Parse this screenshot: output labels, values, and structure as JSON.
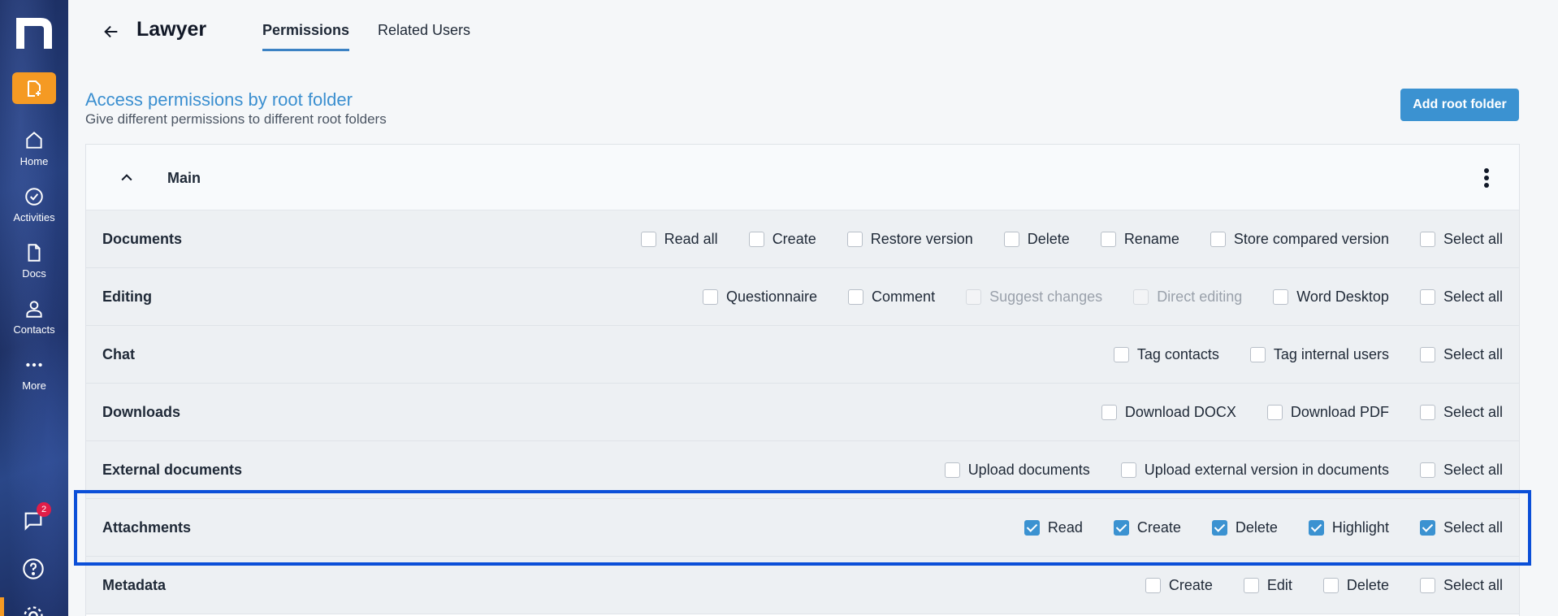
{
  "sidebar": {
    "items": [
      {
        "label": "Home",
        "icon": "home-icon"
      },
      {
        "label": "Activities",
        "icon": "check-circle-icon"
      },
      {
        "label": "Docs",
        "icon": "document-icon"
      },
      {
        "label": "Contacts",
        "icon": "person-icon"
      },
      {
        "label": "More",
        "icon": "more-dots-icon"
      }
    ],
    "chat_badge": "2",
    "colors": {
      "accent": "#f59a23",
      "badge": "#e11d48"
    }
  },
  "header": {
    "title": "Lawyer",
    "tabs": [
      {
        "label": "Permissions",
        "active": true
      },
      {
        "label": "Related Users",
        "active": false
      }
    ]
  },
  "section": {
    "title": "Access permissions by root folder",
    "subtitle": "Give different permissions to different root folders",
    "add_button": "Add root folder"
  },
  "folder": {
    "name": "Main",
    "rows": [
      {
        "label": "Documents",
        "options": [
          {
            "label": "Read all",
            "checked": false,
            "disabled": false
          },
          {
            "label": "Create",
            "checked": false,
            "disabled": false
          },
          {
            "label": "Restore version",
            "checked": false,
            "disabled": false
          },
          {
            "label": "Delete",
            "checked": false,
            "disabled": false
          },
          {
            "label": "Rename",
            "checked": false,
            "disabled": false
          },
          {
            "label": "Store compared version",
            "checked": false,
            "disabled": false
          },
          {
            "label": "Select all",
            "checked": false,
            "disabled": false
          }
        ]
      },
      {
        "label": "Editing",
        "options": [
          {
            "label": "Questionnaire",
            "checked": false,
            "disabled": false
          },
          {
            "label": "Comment",
            "checked": false,
            "disabled": false
          },
          {
            "label": "Suggest changes",
            "checked": false,
            "disabled": true
          },
          {
            "label": "Direct editing",
            "checked": false,
            "disabled": true
          },
          {
            "label": "Word Desktop",
            "checked": false,
            "disabled": false
          },
          {
            "label": "Select all",
            "checked": false,
            "disabled": false
          }
        ]
      },
      {
        "label": "Chat",
        "options": [
          {
            "label": "Tag contacts",
            "checked": false,
            "disabled": false
          },
          {
            "label": "Tag internal users",
            "checked": false,
            "disabled": false
          },
          {
            "label": "Select all",
            "checked": false,
            "disabled": false
          }
        ]
      },
      {
        "label": "Downloads",
        "options": [
          {
            "label": "Download DOCX",
            "checked": false,
            "disabled": false
          },
          {
            "label": "Download PDF",
            "checked": false,
            "disabled": false
          },
          {
            "label": "Select all",
            "checked": false,
            "disabled": false
          }
        ]
      },
      {
        "label": "External documents",
        "options": [
          {
            "label": "Upload documents",
            "checked": false,
            "disabled": false
          },
          {
            "label": "Upload external version in documents",
            "checked": false,
            "disabled": false
          },
          {
            "label": "Select all",
            "checked": false,
            "disabled": false
          }
        ]
      },
      {
        "label": "Attachments",
        "options": [
          {
            "label": "Read",
            "checked": true,
            "disabled": false
          },
          {
            "label": "Create",
            "checked": true,
            "disabled": false
          },
          {
            "label": "Delete",
            "checked": true,
            "disabled": false
          },
          {
            "label": "Highlight",
            "checked": true,
            "disabled": false
          },
          {
            "label": "Select all",
            "checked": true,
            "disabled": false
          }
        ]
      },
      {
        "label": "Metadata",
        "options": [
          {
            "label": "Create",
            "checked": false,
            "disabled": false
          },
          {
            "label": "Edit",
            "checked": false,
            "disabled": false
          },
          {
            "label": "Delete",
            "checked": false,
            "disabled": false
          },
          {
            "label": "Select all",
            "checked": false,
            "disabled": false
          }
        ]
      }
    ]
  }
}
